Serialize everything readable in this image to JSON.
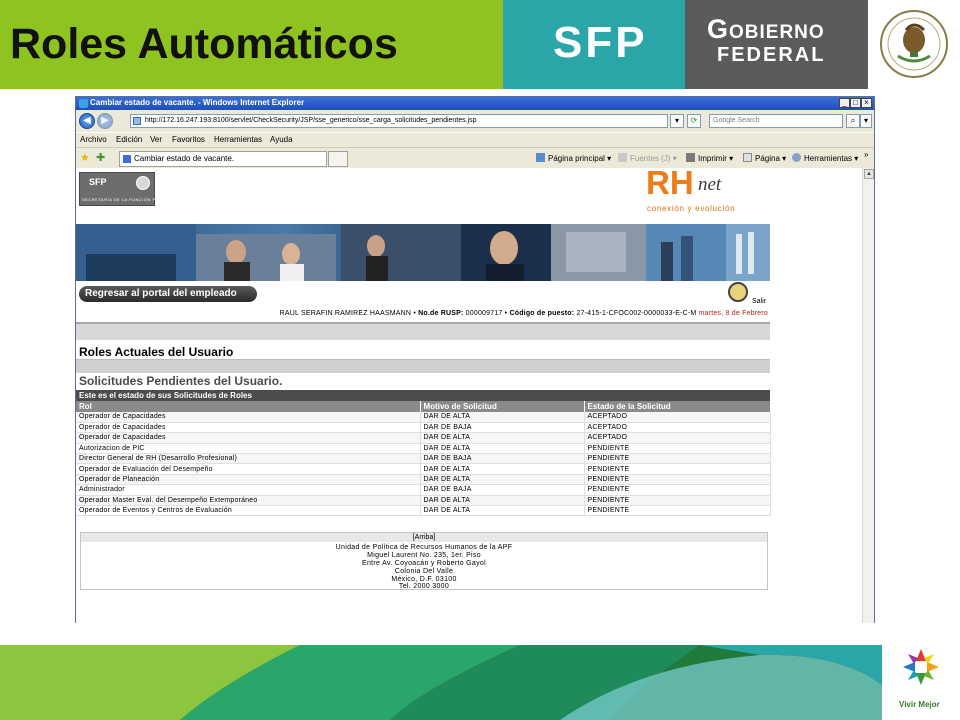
{
  "slide": {
    "title": "Roles Automáticos",
    "sfp_label": "SFP",
    "gobierno_line1": "Gobierno",
    "gobierno_line2": "Federal",
    "footer_logo_text": "Vivir Mejor",
    "colors": {
      "green": "#8fc31f",
      "teal": "#2aa5a8",
      "gray": "#5b5b5b",
      "footer_green": "#2e8b3c"
    }
  },
  "browser": {
    "window_title": "Cambiar estado de vacante. - Windows Internet Explorer",
    "url": "http://172.16.247.193:8100/servlet/CheckSecurity/JSP/sse_generico/sse_carga_solicitudes_pendientes.jsp",
    "search_placeholder": "Google Search",
    "menu": [
      "Archivo",
      "Edición",
      "Ver",
      "Favoritos",
      "Herramientas",
      "Ayuda"
    ],
    "tab_title": "Cambiar estado de vacante.",
    "toolbar": {
      "home": "Página principal",
      "feeds": "Fuentes (J)",
      "print": "Imprimir",
      "page": "Página",
      "tools": "Herramientas"
    }
  },
  "page": {
    "sfp_mini_title": "SFP",
    "sfp_mini_sub": "SECRETARÍA DE LA FUNCIÓN PÚBLICA",
    "rh_brand_rh": "RH",
    "rh_brand_net": "net",
    "rh_tagline": "conexión y evolución",
    "portal_button": "Regresar al portal del empleado",
    "salir": "Salir",
    "user_name": "RAUL SERAFIN RAMIREZ HAASMANN",
    "rusp_label": "No.de RUSP:",
    "rusp_value": "000009717",
    "puesto_label": "Código de puesto:",
    "puesto_value": "27-415-1-CFOC002-0000033-E-C-M",
    "date": "martes, 8 de Febrero",
    "roles_actuales": "Roles Actuales del Usuario",
    "solicitudes_title": "Solicitudes Pendientes del Usuario.",
    "estado_bar": "Este es el estado de sus Solicitudes de Roles",
    "table": {
      "headers": [
        "Rol",
        "Motivo de Solicitud",
        "Estado de la Solicitud"
      ],
      "rows": [
        [
          "Operador de Capacidades",
          "DAR DE ALTA",
          "ACEPTADO"
        ],
        [
          "Operador de Capacidades",
          "DAR DE BAJA",
          "ACEPTADO"
        ],
        [
          "Operador de Capacidades",
          "DAR DE ALTA",
          "ACEPTADO"
        ],
        [
          "Autorizacion de PIC",
          "DAR DE ALTA",
          "PENDIENTE"
        ],
        [
          "Director General de RH (Desarrollo Profesional)",
          "DAR DE BAJA",
          "PENDIENTE"
        ],
        [
          "Operador de Evaluación del Desempeño",
          "DAR DE ALTA",
          "PENDIENTE"
        ],
        [
          "Operador de Planeación",
          "DAR DE ALTA",
          "PENDIENTE"
        ],
        [
          "Administrador",
          "DAR DE BAJA",
          "PENDIENTE"
        ],
        [
          "Operador Master Eval. del Desempeño Extemporáneo",
          "DAR DE ALTA",
          "PENDIENTE"
        ],
        [
          "Operador de Eventos y Centros de Evaluación",
          "DAR DE ALTA",
          "PENDIENTE"
        ]
      ]
    },
    "footer": {
      "arriba": "[Arriba]",
      "lines": [
        "Unidad de Política de Recursos Humanos de la APF",
        "Miguel Laurent No. 235, 1er. Piso",
        "Entre Av. Coyoacán y Roberto Gayol",
        "Colonia Del Valle",
        "México, D.F. 03100",
        "Tel. 2000 3000"
      ]
    }
  }
}
